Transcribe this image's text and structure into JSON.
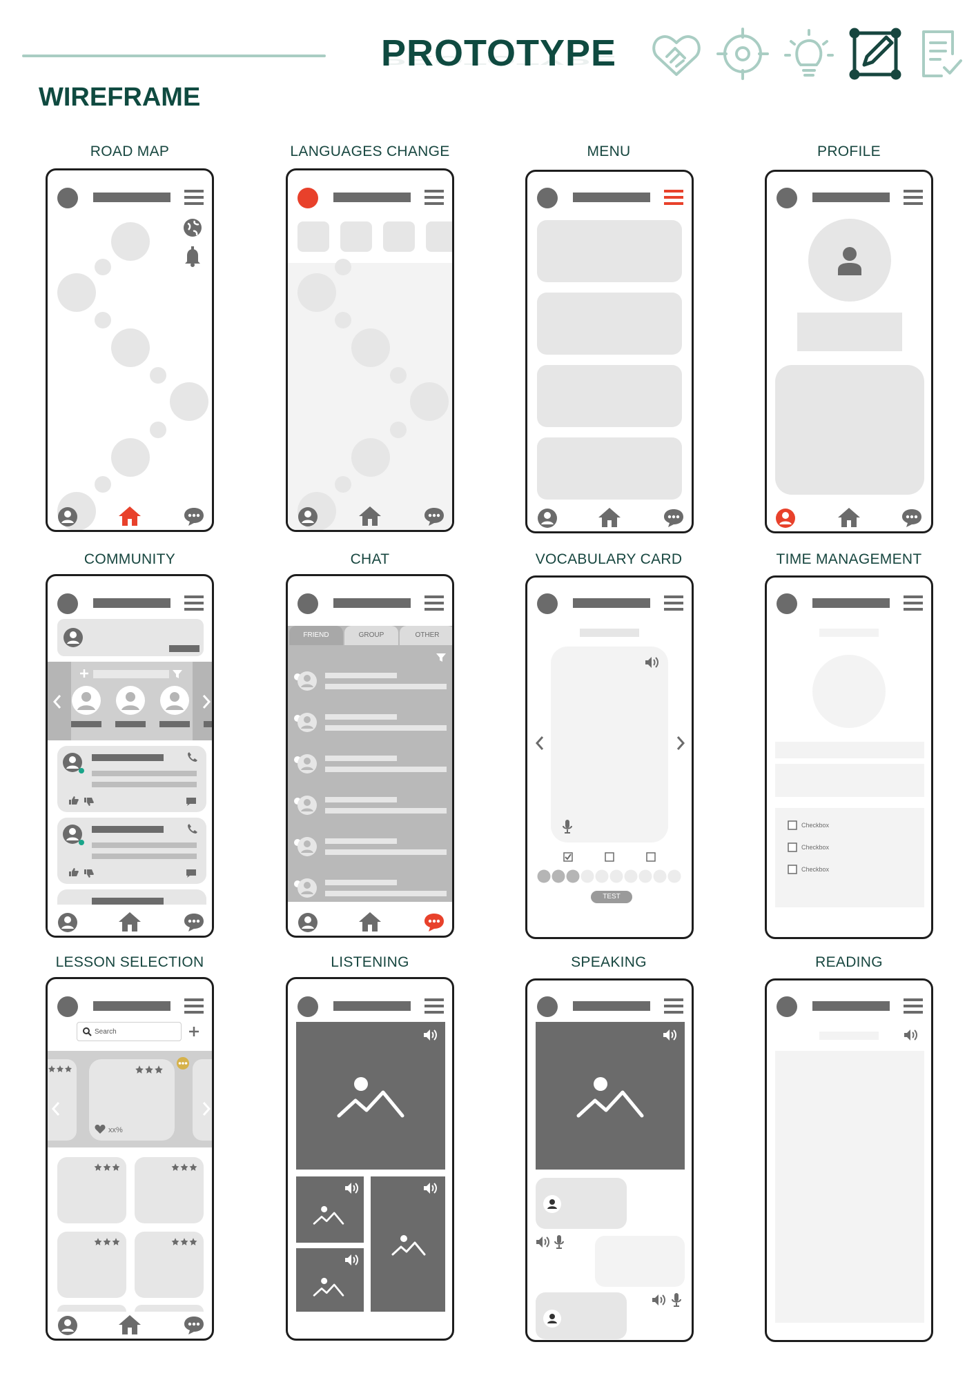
{
  "header": {
    "prototype_title": "PROTOTYPE",
    "wireframe_title": "WIREFRAME",
    "icons": [
      "handshake-icon",
      "target-icon",
      "lightbulb-icon",
      "edit-frame-icon",
      "checklist-icon"
    ]
  },
  "colors": {
    "accent": "#e8412b",
    "brand": "#0f4a40",
    "teal_line": "#a9cdc3",
    "mid_gray": "#6b6b6b",
    "light_gray": "#e6e6e6"
  },
  "screens": [
    {
      "label": "ROAD MAP"
    },
    {
      "label": "LANGUAGES CHANGE"
    },
    {
      "label": "MENU"
    },
    {
      "label": "PROFILE"
    },
    {
      "label": "COMMUNITY"
    },
    {
      "label": "CHAT"
    },
    {
      "label": "VOCABULARY CARD"
    },
    {
      "label": "TIME MANAGEMENT"
    },
    {
      "label": "LESSON SELECTION"
    },
    {
      "label": "LISTENING"
    },
    {
      "label": "SPEAKING"
    },
    {
      "label": "READING"
    }
  ],
  "chat_tabs": [
    "FRIEND",
    "GROUP",
    "OTHER"
  ],
  "vocab": {
    "test_button": "TEST"
  },
  "time_management": {
    "checkboxes": [
      "Checkbox",
      "Checkbox",
      "Checkbox"
    ]
  },
  "lesson": {
    "search_placeholder": "Search",
    "percent": "xx%"
  }
}
